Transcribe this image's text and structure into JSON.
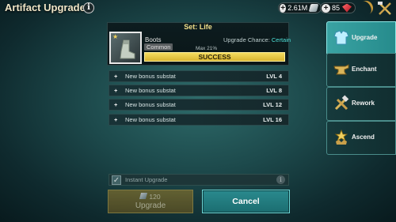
{
  "header": {
    "title": "Artifact Upgrade",
    "info_symbol": "i",
    "silver": "2.61M",
    "gems": "85"
  },
  "artifact": {
    "set_label": "Set: Life",
    "name": "Boots",
    "rarity": "Common",
    "chance_prefix": "Upgrade Chance: ",
    "chance_value": "Certain",
    "max_label": "Max 21%",
    "result": "SUCCESS"
  },
  "substats": [
    {
      "label": "New bonus substat",
      "level": "LVL 4"
    },
    {
      "label": "New bonus substat",
      "level": "LVL 8"
    },
    {
      "label": "New bonus substat",
      "level": "LVL 12"
    },
    {
      "label": "New bonus substat",
      "level": "LVL 16"
    }
  ],
  "instant_upgrade": {
    "label": "Instant Upgrade",
    "checkmark": "✓",
    "checked": true
  },
  "buttons": {
    "upgrade_cost": "120",
    "upgrade_label": "Upgrade",
    "cancel_label": "Cancel"
  },
  "tabs": [
    {
      "label": "Upgrade",
      "icon": "armor-icon",
      "active": true
    },
    {
      "label": "Enchant",
      "icon": "anvil-icon",
      "active": false
    },
    {
      "label": "Rework",
      "icon": "hammer-wrench-icon",
      "active": false
    },
    {
      "label": "Ascend",
      "icon": "crown-star-icon",
      "active": false
    }
  ],
  "colors": {
    "accent_teal": "#2a8a8e",
    "success_yellow": "#f4dc5e",
    "chance_cyan": "#4ee0d8"
  }
}
